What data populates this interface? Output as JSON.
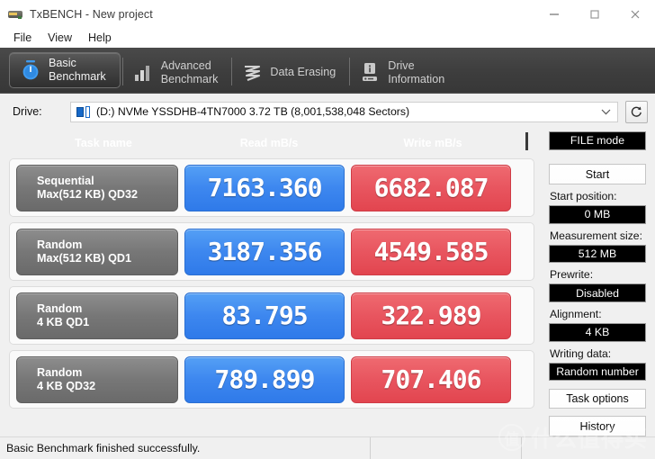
{
  "window": {
    "title": "TxBENCH - New project",
    "app_icon": "drive-icon",
    "controls": {
      "minimize": "minimize-icon",
      "maximize": "maximize-icon",
      "close": "close-icon"
    }
  },
  "menu": {
    "items": [
      {
        "label": "File"
      },
      {
        "label": "View"
      },
      {
        "label": "Help"
      }
    ]
  },
  "tabs": [
    {
      "label": "Basic\nBenchmark",
      "icon": "stopwatch-icon",
      "active": true
    },
    {
      "label": "Advanced\nBenchmark",
      "icon": "bar-chart-icon",
      "active": false
    },
    {
      "label": "Data Erasing",
      "icon": "shredder-icon",
      "active": false
    },
    {
      "label": "Drive\nInformation",
      "icon": "drive-info-icon",
      "active": false
    }
  ],
  "drive": {
    "label": "Drive:",
    "selected": "(D:) NVMe YSSDHB-4TN7000  3.72 TB (8,001,538,048 Sectors)",
    "dropdown_icon": "chevron-down-icon",
    "refresh_icon": "refresh-icon"
  },
  "results": {
    "headers": {
      "task": "Task name",
      "read": "Read mB/s",
      "write": "Write mB/s"
    },
    "rows": [
      {
        "task_line1": "Sequential",
        "task_line2": "Max(512 KB) QD32",
        "read": "7163.360",
        "write": "6682.087"
      },
      {
        "task_line1": "Random",
        "task_line2": "Max(512 KB) QD1",
        "read": "3187.356",
        "write": "4549.585"
      },
      {
        "task_line1": "Random",
        "task_line2": "4 KB QD1",
        "read": "83.795",
        "write": "322.989"
      },
      {
        "task_line1": "Random",
        "task_line2": "4 KB QD32",
        "read": "789.899",
        "write": "707.406"
      }
    ],
    "colors": {
      "read": "#3d87ef",
      "write": "#e8555f",
      "task": "#777777"
    }
  },
  "sidebar": {
    "mode_button": "FILE mode",
    "start_button": "Start",
    "start_position_label": "Start position:",
    "start_position_value": "0 MB",
    "measurement_size_label": "Measurement size:",
    "measurement_size_value": "512 MB",
    "prewrite_label": "Prewrite:",
    "prewrite_value": "Disabled",
    "alignment_label": "Alignment:",
    "alignment_value": "4 KB",
    "writing_data_label": "Writing data:",
    "writing_data_value": "Random number",
    "task_options_button": "Task options",
    "history_button": "History"
  },
  "statusbar": {
    "message": "Basic Benchmark finished successfully.",
    "segment2": "",
    "segment3": ""
  },
  "watermark": {
    "mark": "值",
    "text": "什么值得买"
  }
}
